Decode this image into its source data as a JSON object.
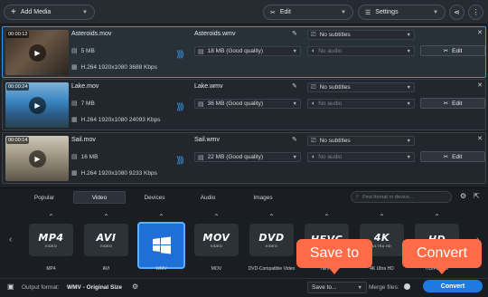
{
  "toolbar": {
    "add_media": "Add Media",
    "edit": "Edit",
    "settings": "Settings"
  },
  "files": [
    {
      "time": "00:00:12",
      "source_name": "Asteroids.mov",
      "source_size": "5 MB",
      "codec": "H.264 1920x1080 3688 Kbps",
      "output_name": "Asteroids.wmv",
      "output_size": "18 MB (Good quality)",
      "subtitles": "No subtitles",
      "audio": "No audio",
      "edit_label": "Edit"
    },
    {
      "time": "00:00:24",
      "source_name": "Lake.mov",
      "source_size": "7 MB",
      "codec": "H.264 1920x1080 24093 Kbps",
      "output_name": "Lake.wmv",
      "output_size": "36 MB (Good quality)",
      "subtitles": "No subtitles",
      "audio": "No audio",
      "edit_label": "Edit"
    },
    {
      "time": "00:00:14",
      "source_name": "Sail.mov",
      "source_size": "16 MB",
      "codec": "H.264 1920x1080 9233 Kbps",
      "output_name": "Sail.wmv",
      "output_size": "22 MB (Good quality)",
      "subtitles": "No subtitles",
      "audio": "No audio",
      "edit_label": "Edit"
    }
  ],
  "tabs": [
    "Popular",
    "Video",
    "Devices",
    "Audio",
    "Images"
  ],
  "active_tab": "Video",
  "search_placeholder": "Find format or device...",
  "formats": [
    {
      "big": "MP4",
      "small": "VIDEO",
      "label": "MP4"
    },
    {
      "big": "AVI",
      "small": "VIDEO",
      "label": "AVI"
    },
    {
      "big": "",
      "small": "",
      "label": "WMV"
    },
    {
      "big": "MOV",
      "small": "VIDEO",
      "label": "MOV"
    },
    {
      "big": "DVD",
      "small": "VIDEO",
      "label": "DVD-Compatible Video"
    },
    {
      "big": "HEVC",
      "small": "",
      "label": "HEVC"
    },
    {
      "big": "4K",
      "small": "ULTRA HD",
      "label": "4K Ultra HD"
    },
    {
      "big": "HD",
      "small": "",
      "label": "HD/Full HD"
    }
  ],
  "bottom": {
    "output_format_label": "Output format:",
    "output_format_value": "WMV - Original Size",
    "save_to": "Save to...",
    "merge_files": "Merge files:",
    "convert": "Convert"
  },
  "callouts": {
    "save_to": "Save to",
    "convert": "Convert"
  },
  "colors": {
    "accent": "#1f7ae0",
    "callout": "#ff6a47",
    "background": "#1e2227"
  }
}
